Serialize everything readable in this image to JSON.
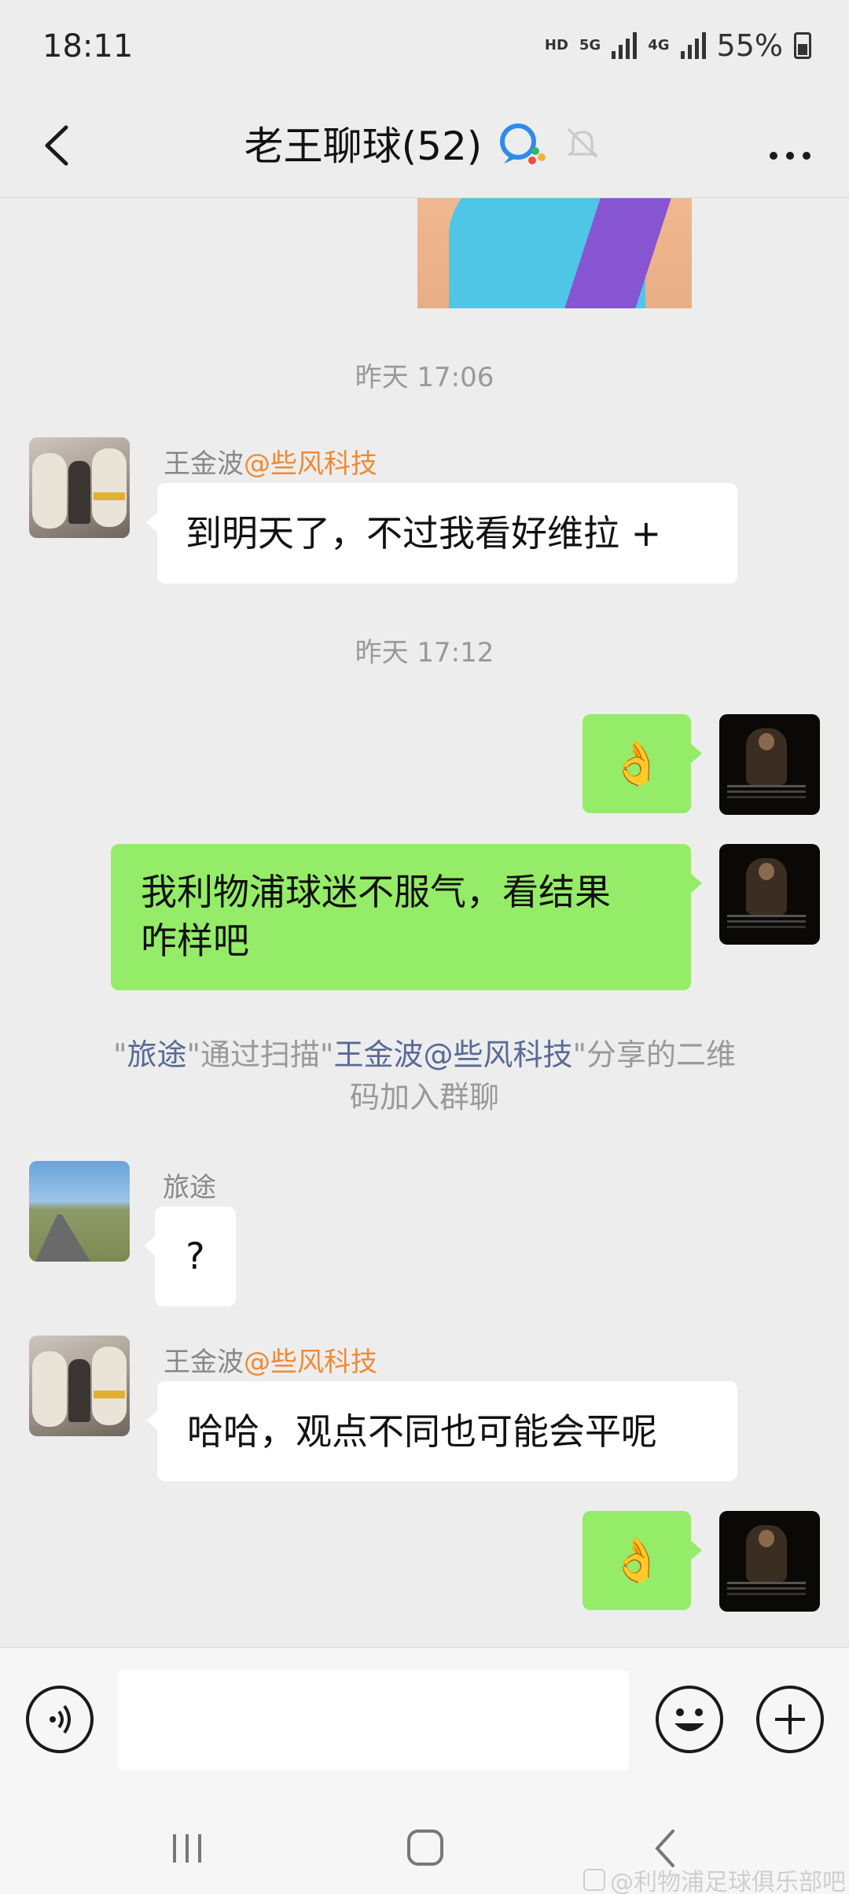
{
  "status_bar": {
    "time": "18:11",
    "hd": "HD",
    "net5g": "5G",
    "net4g": "4G",
    "battery": "55%"
  },
  "header": {
    "title": "老王聊球(52)"
  },
  "messages": {
    "ts1": "昨天 17:06",
    "msg1": {
      "sender_name": "王金波",
      "sender_org": "@些风科技",
      "text": "到明天了，不过我看好维拉 +"
    },
    "ts2": "昨天 17:12",
    "msg2": {
      "text": "👌"
    },
    "msg3": {
      "line1": "我利物浦球迷不服气，看结果",
      "line2": "咋样吧"
    },
    "sys": {
      "q1": "\"",
      "name1": "旅途",
      "mid": "\"通过扫描\"",
      "name2": "王金波@些风科技",
      "tail1": "\"分享的二维",
      "tail2": "码加入群聊"
    },
    "msg4": {
      "sender_name": "旅途",
      "text": "?"
    },
    "msg5": {
      "sender_name": "王金波",
      "sender_org": "@些风科技",
      "text": "哈哈，观点不同也可能会平呢"
    },
    "msg6": {
      "text": "👌"
    }
  },
  "input_bar": {
    "value": ""
  },
  "watermark": {
    "text": "@利物浦足球俱乐部吧"
  }
}
